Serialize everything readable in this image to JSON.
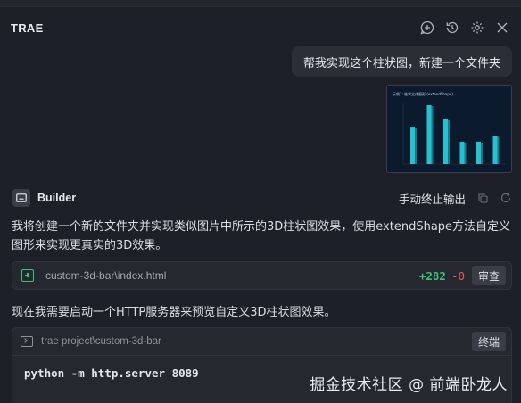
{
  "app": {
    "title": "TRAE"
  },
  "header_icons": [
    "new-chat-icon",
    "history-icon",
    "settings-icon",
    "close-icon"
  ],
  "user_message": {
    "text": "帮我实现这个柱状图，新建一个文件夹"
  },
  "attachment": {
    "title": "示例1: 柱状立体图形 (extendShape)",
    "chart_data": {
      "type": "bar",
      "values": [
        62,
        100,
        76,
        38,
        38,
        48
      ],
      "color": "#2bd1e0"
    }
  },
  "assistant": {
    "name": "Builder",
    "stop_label": "手动终止输出",
    "message1": "我将创建一个新的文件夹并实现类似图片中所示的3D柱状图效果，使用extendShape方法自定义图形来实现更真实的3D效果。",
    "file_change": {
      "path": "custom-3d-bar\\index.html",
      "added": "+282",
      "removed": "-0",
      "review_label": "审查"
    },
    "message2": "现在我需要启动一个HTTP服务器来预览自定义3D柱状图效果。",
    "terminal": {
      "cwd": "trae project\\custom-3d-bar",
      "button_label": "终端",
      "command": "python -m http.server 8089"
    }
  },
  "watermark": "掘金技术社区 @ 前端卧龙人",
  "colors": {
    "background": "#1e2029",
    "card": "#262830",
    "added": "#3cbf7a",
    "removed": "#e05a5a"
  }
}
